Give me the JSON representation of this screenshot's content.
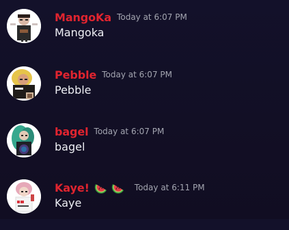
{
  "messages": [
    {
      "username": "MangoKa",
      "timestamp": "Today at 6:07 PM",
      "content": "Mangoka",
      "avatar": "avatar-black-shirt-character"
    },
    {
      "username": "Pebble",
      "timestamp": "Today at 6:07 PM",
      "content": "Pebble",
      "avatar": "avatar-blonde-character"
    },
    {
      "username": "bagel",
      "timestamp": "Today at 6:07 PM",
      "content": "bagel",
      "avatar": "avatar-teal-hair-character"
    },
    {
      "username": "Kaye!",
      "timestamp": "Today at 6:11 PM",
      "content": "Kaye",
      "avatar": "avatar-pink-hair-character",
      "name_emojis": [
        "watermelon-icon",
        "watermelon-icon"
      ]
    }
  ],
  "colors": {
    "background": "#130f26",
    "username": "#e0242f",
    "timestamp": "#a3a5b0",
    "content": "#eeeff4"
  }
}
